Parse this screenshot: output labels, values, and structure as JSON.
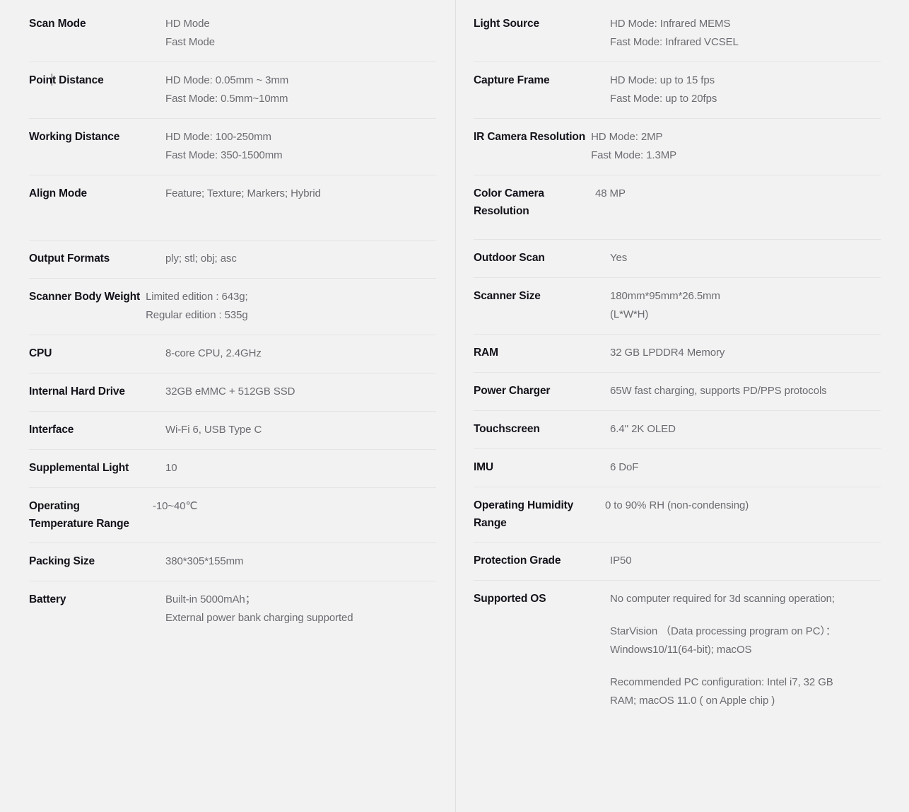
{
  "theme": {
    "background": "#f2f2f2",
    "label_color": "#12121a",
    "value_color": "#6b6b72",
    "rule_color": "#e4e4e4",
    "divider_color": "#e0e0e0"
  },
  "left_column": {
    "rows": [
      {
        "label_prefix": "Poin",
        "label": "Scan Mode",
        "lines": [
          "HD Mode",
          "Fast Mode"
        ]
      },
      {
        "label": "Point Distance",
        "label_part_a": "Poin",
        "label_part_b": "t Distance",
        "lines": [
          "HD Mode: 0.05mm ~ 3mm",
          "Fast Mode: 0.5mm~10mm"
        ]
      },
      {
        "label": "Working Distance",
        "lines": [
          "HD Mode: 100-250mm",
          "Fast Mode: 350-1500mm"
        ]
      },
      {
        "label": "Align Mode",
        "lines": [
          "Feature; Texture; Markers; Hybrid"
        ]
      },
      {
        "label": "Output Formats",
        "lines": [
          "ply; stl; obj; asc"
        ]
      },
      {
        "label": "Scanner Body Weight",
        "lines": [
          "Limited edition : 643g;",
          "Regular edition : 535g"
        ]
      },
      {
        "label": "CPU",
        "lines": [
          "8-core CPU, 2.4GHz"
        ]
      },
      {
        "label": "Internal Hard Drive",
        "lines": [
          "32GB eMMC + 512GB SSD"
        ]
      },
      {
        "label": "Interface",
        "lines": [
          "Wi-Fi 6, USB Type C"
        ]
      },
      {
        "label": "Supplemental Light",
        "lines": [
          "10"
        ]
      },
      {
        "label": "Operating Temperature Range",
        "lines": [
          "-10~40℃"
        ]
      },
      {
        "label": "Packing Size",
        "lines": [
          "380*305*155mm"
        ]
      },
      {
        "label": "Battery",
        "lines": [
          "Built-in 5000mAh；",
          "External power bank charging supported"
        ]
      }
    ]
  },
  "right_column": {
    "rows": [
      {
        "label": "Light Source",
        "lines": [
          "HD Mode: Infrared MEMS",
          "Fast Mode: Infrared VCSEL"
        ]
      },
      {
        "label": "Capture Frame",
        "lines": [
          "HD Mode: up to 15 fps",
          "Fast Mode: up to 20fps"
        ]
      },
      {
        "label": "IR Camera Resolution",
        "lines": [
          "HD Mode: 2MP",
          "Fast Mode: 1.3MP"
        ]
      },
      {
        "label": "Color Camera Resolution",
        "lines": [
          "48 MP"
        ]
      },
      {
        "label": "Outdoor Scan",
        "lines": [
          "Yes"
        ]
      },
      {
        "label": "Scanner Size",
        "lines": [
          "180mm*95mm*26.5mm",
          "(L*W*H)"
        ]
      },
      {
        "label": "RAM",
        "lines": [
          "32 GB LPDDR4 Memory"
        ]
      },
      {
        "label": "Power Charger",
        "lines": [
          "65W fast charging, supports PD/PPS protocols"
        ]
      },
      {
        "label": "Touchscreen",
        "lines": [
          "6.4'' 2K OLED"
        ]
      },
      {
        "label": "IMU",
        "lines": [
          "6 DoF"
        ]
      },
      {
        "label": "Operating Humidity Range",
        "lines": [
          "0 to 90% RH (non-condensing)"
        ]
      },
      {
        "label": "Protection Grade",
        "lines": [
          "IP50"
        ]
      },
      {
        "label": "Supported OS",
        "paragraphs": [
          "No computer required for 3d scanning operation;",
          "StarVision （Data processing program on PC）： Windows10/11(64-bit); macOS",
          "Recommended PC configuration: Intel i7, 32 GB RAM; macOS 11.0 ( on Apple chip )"
        ]
      }
    ]
  }
}
